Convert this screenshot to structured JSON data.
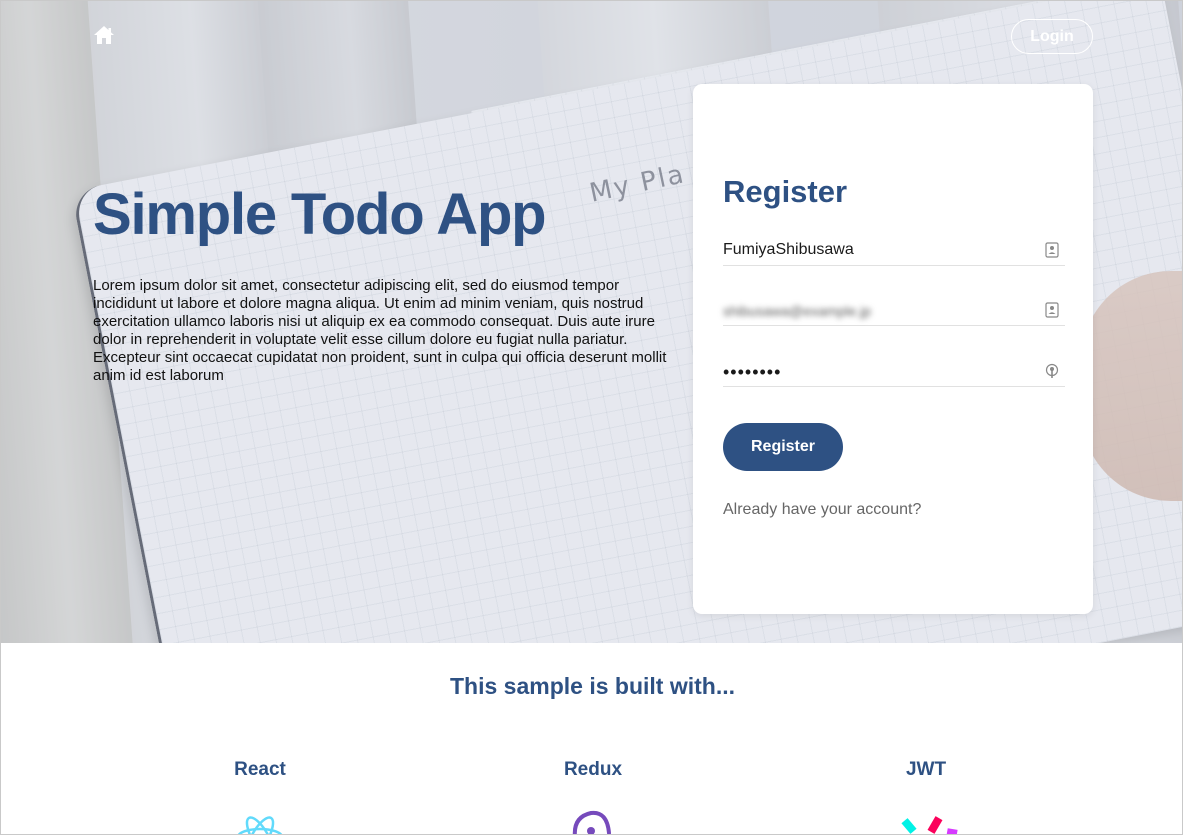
{
  "nav": {
    "home_icon": "home-icon",
    "login_label": "Login"
  },
  "hero": {
    "title": "Simple Todo App",
    "body": "Lorem ipsum dolor sit amet, consectetur adipiscing elit, sed do eiusmod tempor incididunt ut labore et dolore magna aliqua. Ut enim ad minim veniam, quis nostrud exercitation ullamco laboris nisi ut aliquip ex ea commodo consequat. Duis aute irure dolor in reprehenderit in voluptate velit esse cillum dolore eu fugiat nulla pariatur. Excepteur sint occaecat cupidatat non proident, sunt in culpa qui officia deserunt mollit anim id est laborum",
    "handwriting": "My Pla"
  },
  "register_form": {
    "title": "Register",
    "username_value": "FumiyaShibusawa",
    "username_icon": "contact-card-icon",
    "email_value": "shibusawa@example.jp",
    "email_icon": "contact-card-icon",
    "password_value": "••••••••",
    "password_icon": "key-icon",
    "submit_label": "Register",
    "account_link": "Already have your account?"
  },
  "built_with": {
    "title": "This sample is built with...",
    "items": [
      {
        "name": "React",
        "icon": "react-logo-icon",
        "color": "#61dafb"
      },
      {
        "name": "Redux",
        "icon": "redux-logo-icon",
        "color": "#764abc"
      },
      {
        "name": "JWT",
        "icon": "jwt-logo-icon",
        "color": "#00f2e6"
      }
    ]
  },
  "colors": {
    "brand": "#2e5183",
    "card": "#ffffff",
    "muted_text": "#666666"
  }
}
